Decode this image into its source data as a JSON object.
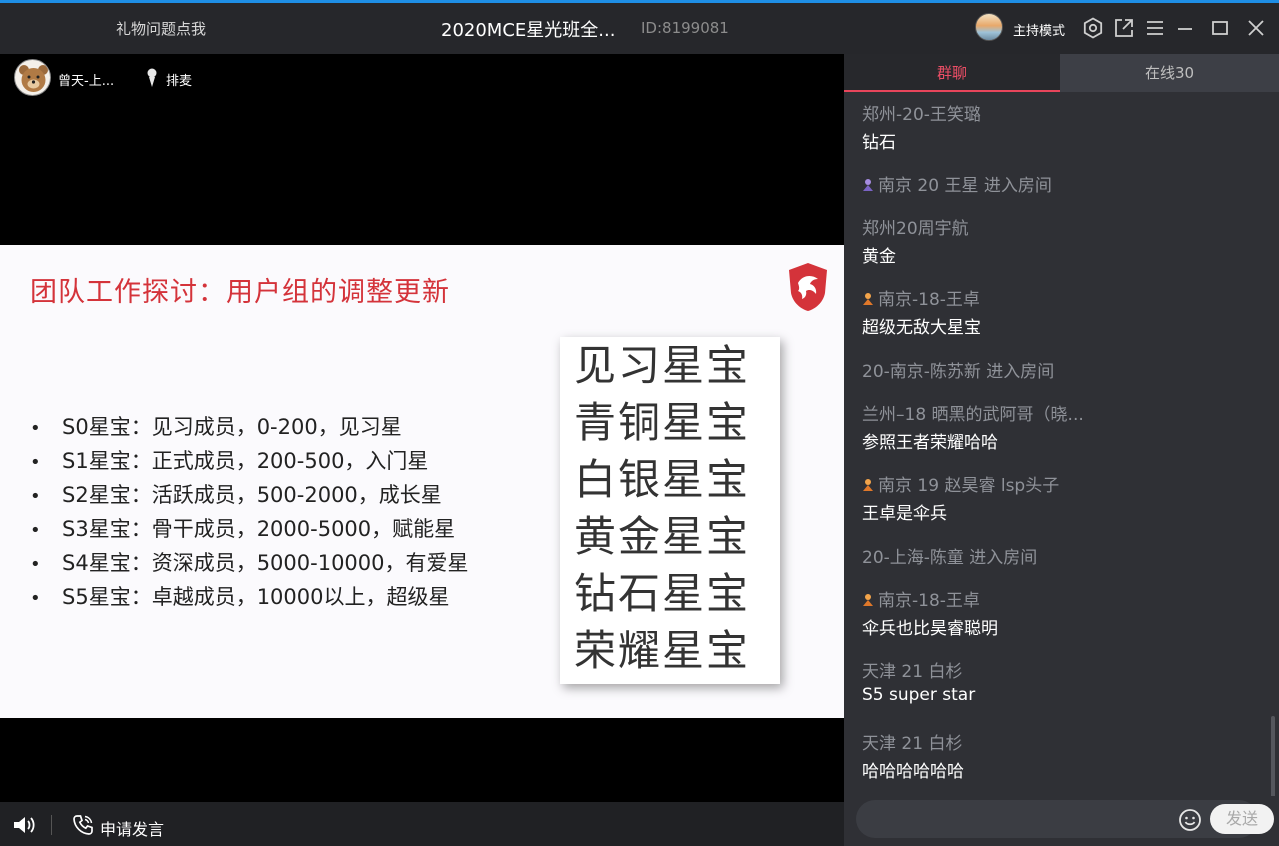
{
  "titlebar": {
    "gift_link": "礼物问题点我",
    "room_title": "2020MCE星光班全...",
    "room_id": "ID:8199081",
    "host_mode": "主持模式",
    "icons": [
      "settings-icon",
      "popout-icon",
      "menu-icon",
      "minimize-icon",
      "maximize-icon",
      "close-icon"
    ]
  },
  "video": {
    "presenter_name": "曾天-上...",
    "queue_label": "排麦"
  },
  "slide": {
    "title": "团队工作探讨：用户组的调整更新",
    "bullets": [
      "S0星宝：见习成员，0-200，见习星",
      "S1星宝：正式成员，200-500，入门星",
      "S2星宝：活跃成员，500-2000，成长星",
      "S3星宝：骨干成员，2000-5000，赋能星",
      "S4星宝：资深成员，5000-10000，有爱星",
      "S5星宝：卓越成员，10000以上，超级星"
    ],
    "badges": [
      "见习星宝",
      "青铜星宝",
      "白银星宝",
      "黄金星宝",
      "钻石星宝",
      "荣耀星宝"
    ],
    "bullet_symbol": "•",
    "title_color": "#d4333a"
  },
  "bottombar": {
    "apply_speak": "申请发言"
  },
  "panel": {
    "tab_group": "群聊",
    "tab_online": "在线30",
    "accent_color": "#e8455b",
    "messages": [
      {
        "sender": "郑州-20-王笑璐",
        "text": "钻石",
        "badge": false
      },
      {
        "sender": "南京  20   王星 进入房间",
        "text": "",
        "badge": true
      },
      {
        "sender": "郑州20周宇航",
        "text": "黄金",
        "badge": false
      },
      {
        "sender": "南京-18-王卓",
        "text": "超级无敌大星宝",
        "badge": true
      },
      {
        "sender": "20-南京-陈苏新 进入房间",
        "text": "",
        "badge": false
      },
      {
        "sender": "兰州–18 晒黑的武阿哥（晓...",
        "text": "参照王者荣耀哈哈",
        "badge": false
      },
      {
        "sender": "南京 19 赵昊睿 lsp头子",
        "text": "王卓是伞兵",
        "badge": true
      },
      {
        "sender": "20-上海-陈童 进入房间",
        "text": "",
        "badge": false
      },
      {
        "sender": "南京-18-王卓",
        "text": "伞兵也比昊睿聪明",
        "badge": true
      },
      {
        "sender": "天津 21 白杉",
        "text": "S5 super star",
        "badge": false
      },
      {
        "sender": "天津 21 白杉",
        "text": "哈哈哈哈哈哈",
        "badge": false
      }
    ],
    "send_label": "发送",
    "input_value": ""
  }
}
